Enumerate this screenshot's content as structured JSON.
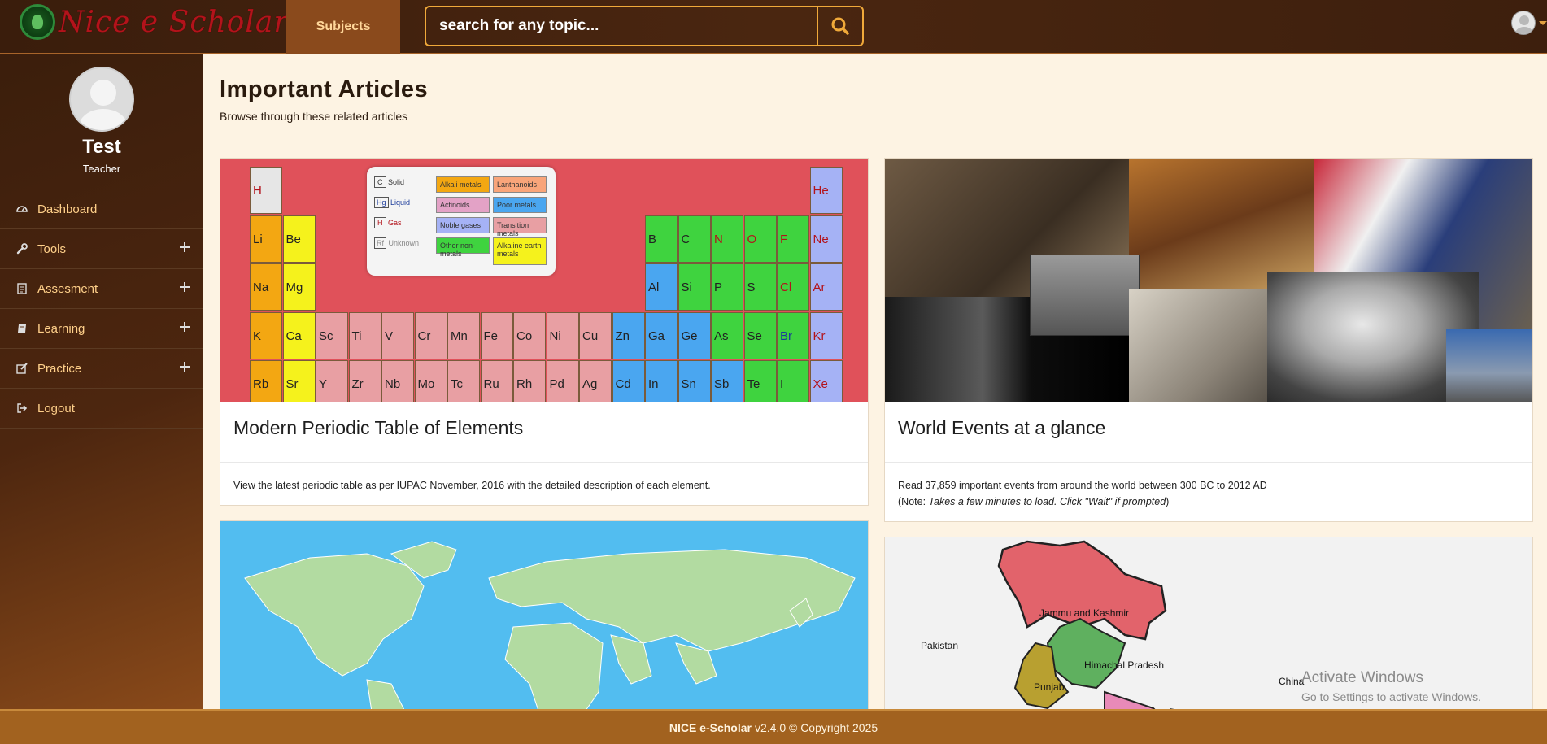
{
  "header": {
    "logo_text": "Nice e Scholar",
    "subjects_label": "Subjects",
    "search_placeholder": "search for any topic..."
  },
  "sidebar": {
    "profile_name": "Test",
    "profile_role": "Teacher",
    "items": [
      {
        "label": "Dashboard",
        "icon": "dashboard-icon",
        "expandable": false
      },
      {
        "label": "Tools",
        "icon": "wrench-icon",
        "expandable": true
      },
      {
        "label": "Assesment",
        "icon": "document-icon",
        "expandable": true
      },
      {
        "label": "Learning",
        "icon": "book-icon",
        "expandable": true
      },
      {
        "label": "Practice",
        "icon": "edit-icon",
        "expandable": true
      },
      {
        "label": "Logout",
        "icon": "logout-icon",
        "expandable": false
      }
    ]
  },
  "main": {
    "title": "Important Articles",
    "subtitle": "Browse through these related articles",
    "cards": [
      {
        "title": "Modern Periodic Table of Elements",
        "text": "View the latest periodic table as per IUPAC November, 2016 with the detailed description of each element."
      },
      {
        "title": "World Events at a glance",
        "text": "Read 37,859 important events from around the world between 300 BC to 2012 AD",
        "note_prefix": "(Note: ",
        "note_italic": "Takes a few minutes to load. Click \"Wait\" if prompted",
        "note_suffix": ")"
      }
    ],
    "india_map_labels": [
      "Jammu and Kashmir",
      "Pakistan",
      "Himachal Pradesh",
      "Punjab",
      "China"
    ]
  },
  "periodic_legend": {
    "states": [
      "Solid",
      "Liquid",
      "Gas",
      "Unknown"
    ],
    "state_symbols": [
      "C",
      "Hg",
      "H",
      "Rf"
    ],
    "groups": [
      "Alkali metals",
      "Lanthanoids",
      "Actinoids",
      "Poor metals",
      "Noble gases",
      "Transition metals",
      "Other non-metals",
      "Alkaline earth metals"
    ]
  },
  "footer": {
    "brand": "NICE e-Scholar",
    "text": "v2.4.0 © Copyright 2025"
  },
  "watermark": {
    "line1": "Activate Windows",
    "line2": "Go to Settings to activate Windows."
  },
  "colors": {
    "accent": "#f0a93a",
    "menu_text": "#ffd08a",
    "footer_bg": "#a2621f"
  }
}
